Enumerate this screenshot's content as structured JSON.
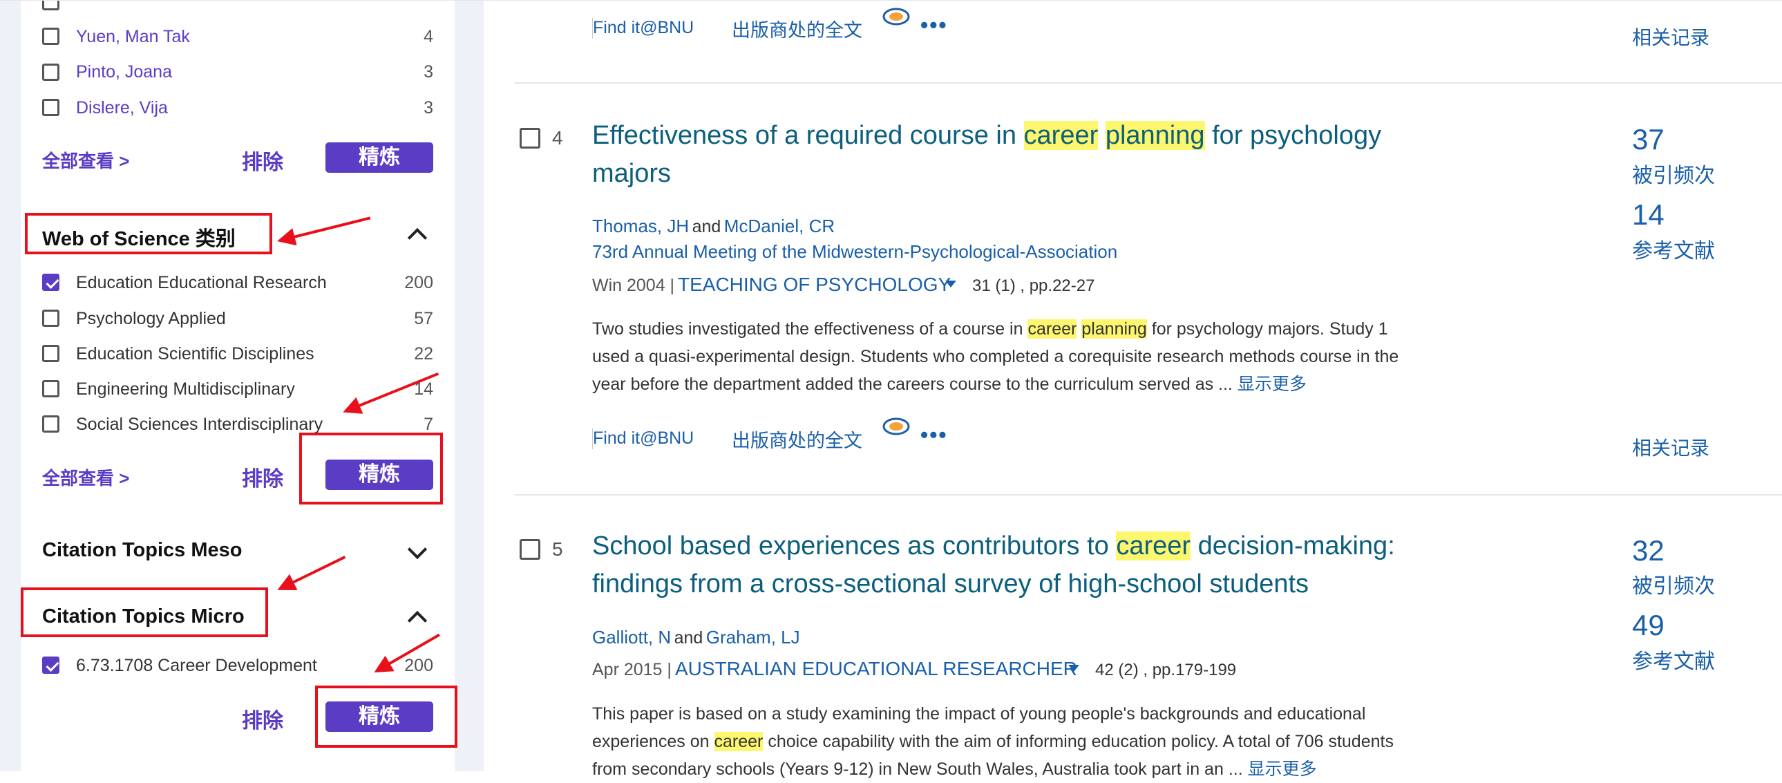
{
  "sidebar": {
    "authors": [
      {
        "label": "Yuen, Man Tak",
        "count": "4"
      },
      {
        "label": "Pinto, Joana",
        "count": "3"
      },
      {
        "label": "Dislere, Vija",
        "count": "3"
      }
    ],
    "view_all": "全部查看 >",
    "exclude": "排除",
    "refine": "精炼",
    "wos_title": "Web of Science 类别",
    "wos_items": [
      {
        "label": "Education Educational Research",
        "count": "200",
        "checked": true
      },
      {
        "label": "Psychology Applied",
        "count": "57",
        "checked": false
      },
      {
        "label": "Education Scientific Disciplines",
        "count": "22",
        "checked": false
      },
      {
        "label": "Engineering Multidisciplinary",
        "count": "14",
        "checked": false
      },
      {
        "label": "Social Sciences Interdisciplinary",
        "count": "7",
        "checked": false
      }
    ],
    "meso_title": "Citation Topics Meso",
    "micro_title": "Citation Topics Micro",
    "micro_items": [
      {
        "label": "6.73.1708 Career Development",
        "count": "200",
        "checked": true
      }
    ]
  },
  "results": {
    "find_it": "Find it@BNU",
    "publisher_fulltext": "出版商处的全文",
    "more_options": "•••",
    "related": "相关记录",
    "times_cited_label": "被引频次",
    "references_label": "参考文献",
    "show_more": "显示更多",
    "records": [
      {
        "num": "4",
        "title_parts": [
          "Effectiveness of a required course in ",
          "career",
          " ",
          "planning",
          " for psychology",
          "majors"
        ],
        "author1": "Thomas, JH",
        "and": "and",
        "author2": "McDaniel, CR",
        "conference": "73rd Annual Meeting of the Midwestern-Psychological-Association",
        "date": "Win 2004 |",
        "journal": "TEACHING OF PSYCHOLOGY",
        "volume": "31 (1) , pp.22-27",
        "abstract_lines": [
          [
            "Two studies investigated the effectiveness of a course in ",
            "career",
            " ",
            "planning",
            " for psychology majors. Study 1"
          ],
          [
            "used a quasi-experimental design. Students who completed a corequisite research methods course in the"
          ],
          [
            "year before the department added the careers course to the curriculum served as  ...  "
          ]
        ],
        "times_cited": "37",
        "references": "14"
      },
      {
        "num": "5",
        "title_parts": [
          "School based experiences as contributors to ",
          "career",
          " decision-making:",
          "findings from a cross-sectional survey of high-school students"
        ],
        "author1": "Galliott, N",
        "and": "and",
        "author2": "Graham, LJ",
        "date": "Apr 2015 |",
        "journal": "AUSTRALIAN EDUCATIONAL RESEARCHER",
        "volume": "42 (2) , pp.179-199",
        "abstract_lines": [
          [
            "This paper is based on a study examining the impact of young people's backgrounds and educational"
          ],
          [
            "experiences on ",
            "career",
            " choice capability with the aim of informing education policy. A total of 706 students"
          ],
          [
            "from secondary schools (Years 9-12) in New South Wales, Australia took part in an  ...  "
          ]
        ],
        "times_cited": "32",
        "references": "49"
      }
    ]
  }
}
